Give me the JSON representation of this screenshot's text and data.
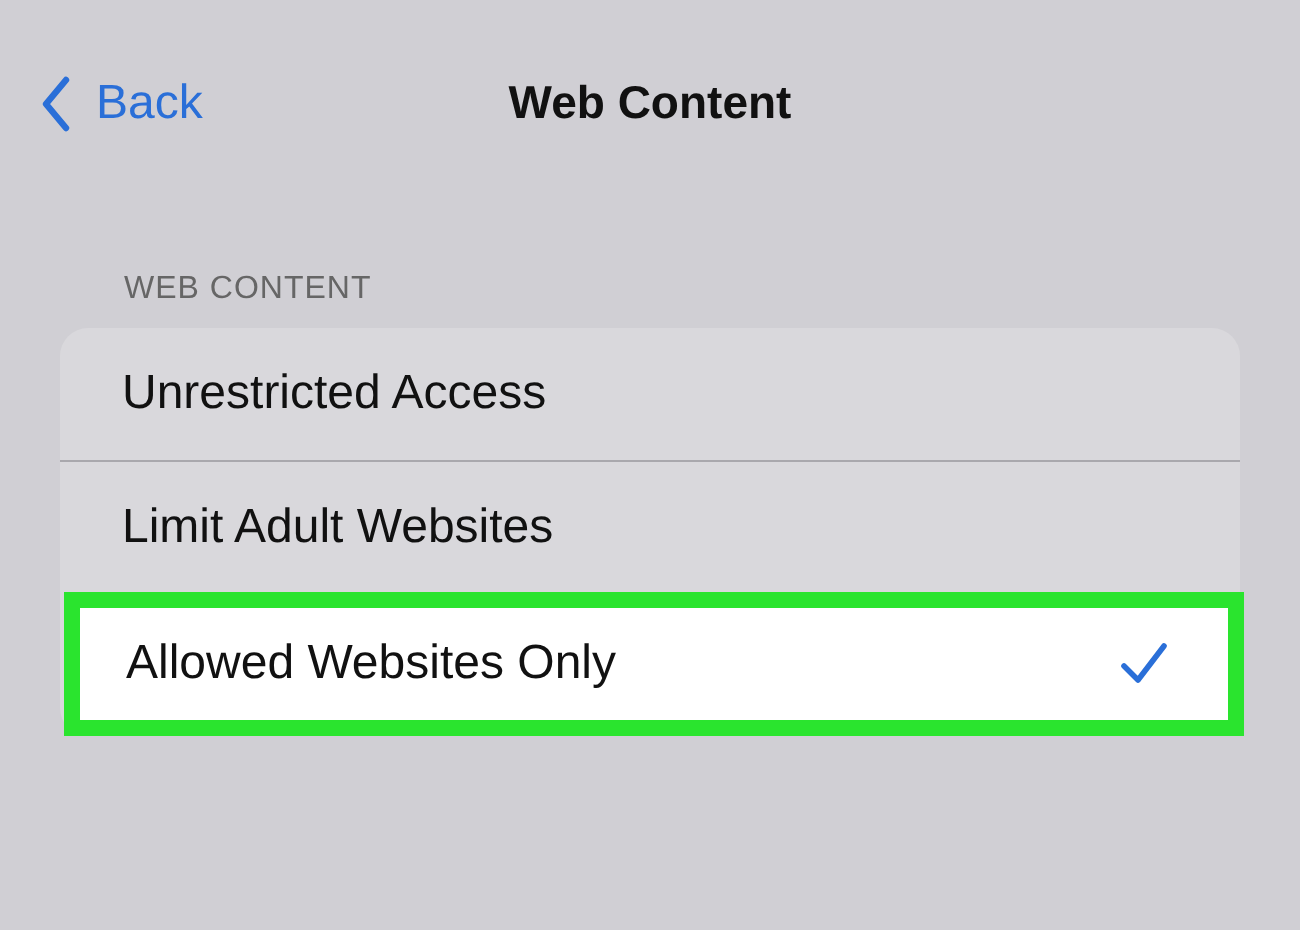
{
  "nav": {
    "back": "Back",
    "title": "Web Content"
  },
  "section": {
    "header": "WEB CONTENT",
    "options": [
      {
        "label": "Unrestricted Access",
        "selected": false
      },
      {
        "label": "Limit Adult Websites",
        "selected": false
      },
      {
        "label": "Allowed Websites Only",
        "selected": true
      }
    ]
  }
}
